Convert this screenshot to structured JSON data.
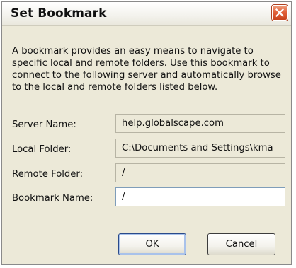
{
  "window": {
    "title": "Set Bookmark",
    "close_icon": "close-x-icon",
    "close_color": "#e2613a"
  },
  "description": "A bookmark provides an easy means to navigate to specific local and remote folders. Use this bookmark to connect to the following server and automatically browse to the local and remote folders listed below.",
  "fields": {
    "server": {
      "label": "Server Name:",
      "value": "help.globalscape.com",
      "editable": false
    },
    "local": {
      "label": "Local Folder:",
      "value": "C:\\Documents and Settings\\kma",
      "editable": false
    },
    "remote": {
      "label": "Remote Folder:",
      "value": "/",
      "editable": false
    },
    "bookmark": {
      "label": "Bookmark Name:",
      "value": "/",
      "editable": true
    }
  },
  "buttons": {
    "ok": "OK",
    "cancel": "Cancel"
  }
}
